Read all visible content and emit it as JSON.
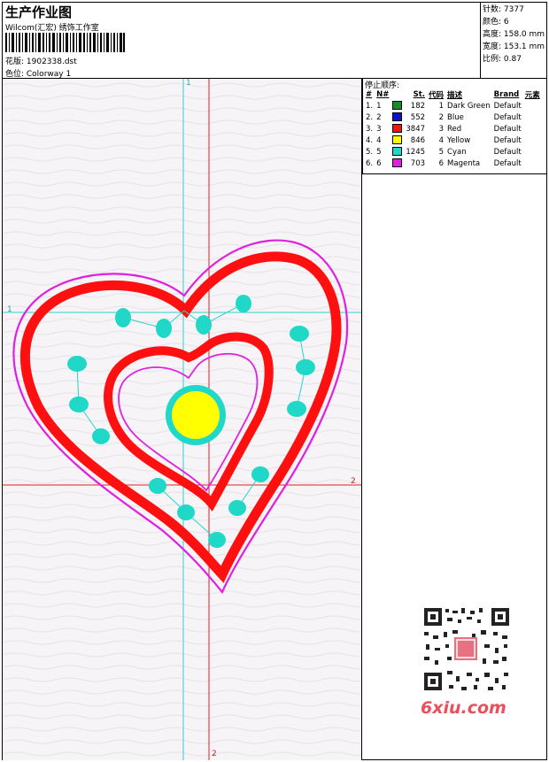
{
  "header": {
    "title": "生产作业图",
    "subtitle": "Wilcom(汇宏) 绣饰工作室",
    "design_label": "花版: 1902338.dst",
    "colorway_label": "色位:  Colorway 1"
  },
  "stats": {
    "stitches": "针数: 7377",
    "colors": "颜色: 6",
    "height": "高度: 158.0 mm",
    "width": "宽度: 153.1 mm",
    "scale": "比例: 0.87"
  },
  "stop_sequence": {
    "title": "停止顺序:",
    "headers": [
      "#",
      "N#",
      "St.",
      "代码",
      "描述",
      "Brand",
      "元素"
    ],
    "rows": [
      {
        "idx": "1.",
        "n": "1",
        "st": "182",
        "code": "1",
        "desc": "Dark Green",
        "brand": "Default",
        "color": "#1a8a2a"
      },
      {
        "idx": "2.",
        "n": "2",
        "st": "552",
        "code": "2",
        "desc": "Blue",
        "brand": "Default",
        "color": "#1010d0"
      },
      {
        "idx": "3.",
        "n": "3",
        "st": "3847",
        "code": "3",
        "desc": "Red",
        "brand": "Default",
        "color": "#ff1010"
      },
      {
        "idx": "4.",
        "n": "4",
        "st": "846",
        "code": "4",
        "desc": "Yellow",
        "brand": "Default",
        "color": "#ffff00"
      },
      {
        "idx": "5.",
        "n": "5",
        "st": "1245",
        "code": "5",
        "desc": "Cyan",
        "brand": "Default",
        "color": "#20d8c8"
      },
      {
        "idx": "6.",
        "n": "6",
        "st": "703",
        "code": "6",
        "desc": "Magenta",
        "brand": "Default",
        "color": "#e020e0"
      }
    ]
  },
  "axes": {
    "label_1": "1",
    "label_2": "2"
  },
  "watermark": "6xiu.com",
  "colors": {
    "red": "#ff1010",
    "magenta": "#e020e0",
    "cyan": "#20d8c8",
    "yellow": "#ffff00",
    "guide_red": "#e02020",
    "guide_cyan": "#30d0d0"
  }
}
